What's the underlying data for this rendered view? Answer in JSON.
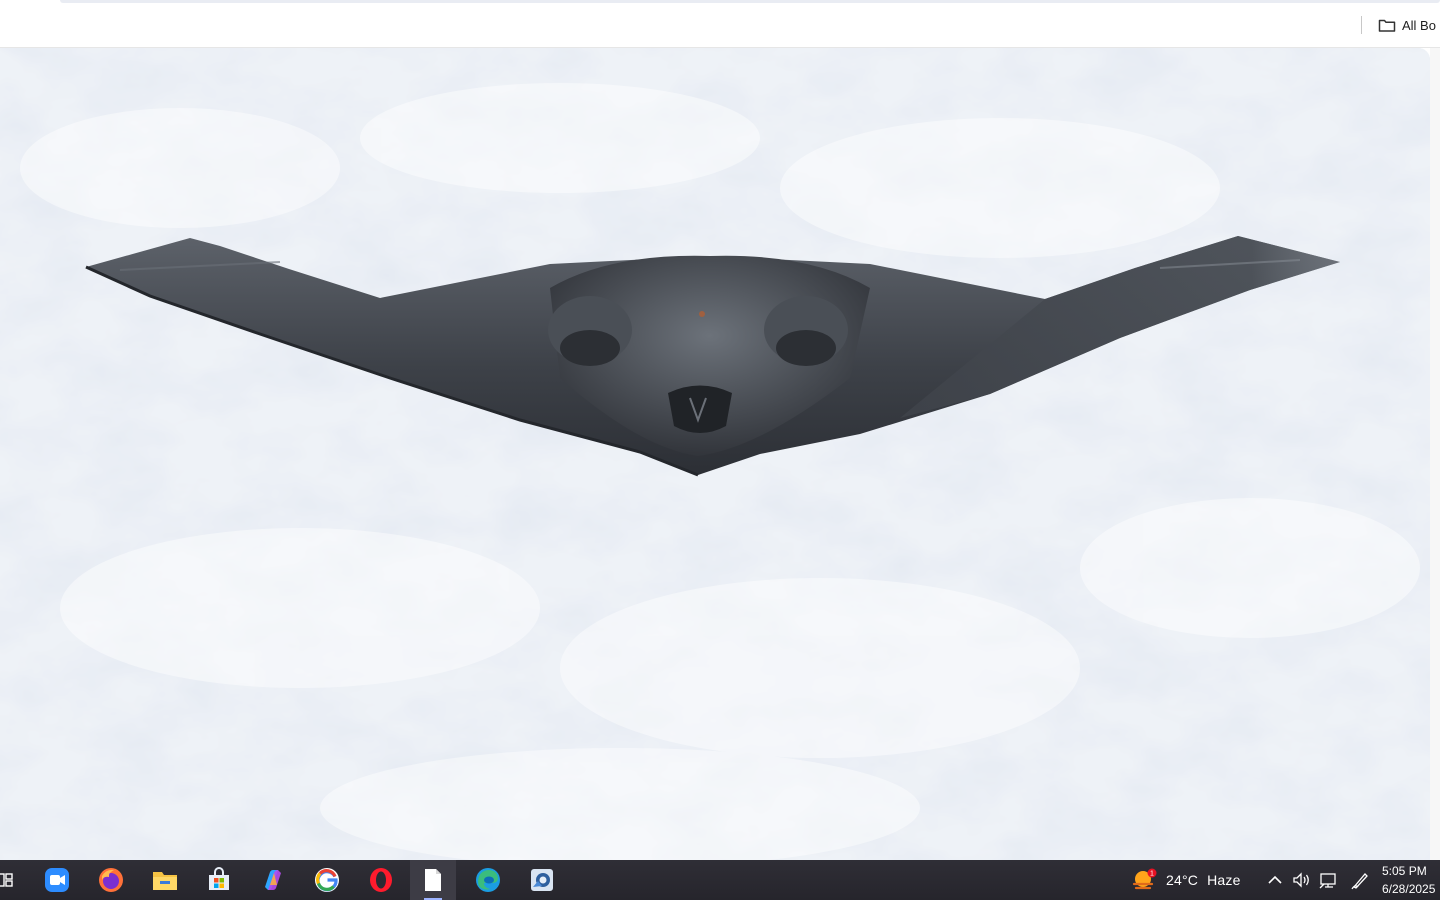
{
  "bookmarks_bar": {
    "all_bookmarks_label": "All Bo"
  },
  "viewer": {
    "subject": "stealth-bomber-photo"
  },
  "taskbar": {
    "pinned_icons": [
      "task-view-icon",
      "zoom-icon",
      "firefox-icon",
      "file-explorer-icon",
      "microsoft-store-icon",
      "copilot-icon",
      "google-chrome-icon",
      "opera-icon",
      "notepad-icon",
      "edge-icon",
      "photo-viewer-icon"
    ],
    "weather": {
      "temperature": "24°C",
      "condition": "Haze"
    },
    "clock": {
      "time": "5:05 PM",
      "date": "6/28/2025"
    }
  },
  "colors": {
    "taskbar_bg": "#2b2a33",
    "sky": "#e9eef5"
  }
}
